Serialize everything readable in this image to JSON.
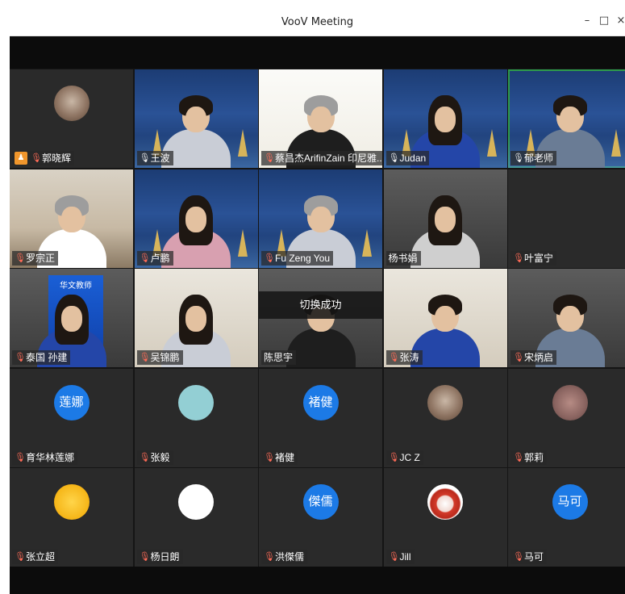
{
  "window": {
    "title": "VooV Meeting",
    "controls": {
      "minimize": "–",
      "maximize": "□",
      "close": "×"
    }
  },
  "participants": [
    {
      "name": "郭晓辉",
      "mic": "muted",
      "host": true,
      "kind": "avatar-photo",
      "active": false
    },
    {
      "name": "王波",
      "mic": "on",
      "host": false,
      "kind": "video-stage",
      "active": false
    },
    {
      "name": "蔡昌杰ArifinZain 印尼雅...",
      "mic": "muted",
      "host": false,
      "kind": "video-paper",
      "active": false
    },
    {
      "name": "Judan",
      "mic": "on",
      "host": false,
      "kind": "video-stage",
      "active": false
    },
    {
      "name": "郁老师",
      "mic": "on",
      "host": false,
      "kind": "video-stage",
      "active": true
    },
    {
      "name": "罗宗正",
      "mic": "muted",
      "host": false,
      "kind": "video-room",
      "active": false
    },
    {
      "name": "卢鹏",
      "mic": "muted",
      "host": false,
      "kind": "video-stage",
      "active": false
    },
    {
      "name": "Fu Zeng You",
      "mic": "muted",
      "host": false,
      "kind": "video-stage",
      "active": false
    },
    {
      "name": "杨书娟",
      "mic": "none",
      "host": false,
      "kind": "video-gray",
      "active": false
    },
    {
      "name": "叶富宁",
      "mic": "muted",
      "host": false,
      "kind": "video-dark",
      "active": false
    },
    {
      "name": "泰国 孙建",
      "mic": "muted",
      "host": false,
      "kind": "video-banner",
      "active": false,
      "banner_text": "华文教师"
    },
    {
      "name": "吴锦鹏",
      "mic": "muted",
      "host": false,
      "kind": "video-wall",
      "active": false
    },
    {
      "name": "陈思宇",
      "mic": "none",
      "host": false,
      "kind": "video-gray",
      "active": false,
      "toast": "切换成功"
    },
    {
      "name": "张涛",
      "mic": "muted",
      "host": false,
      "kind": "video-wall",
      "active": false
    },
    {
      "name": "宋炳启",
      "mic": "muted",
      "host": false,
      "kind": "video-gray",
      "active": false
    },
    {
      "name": "育华林莲娜",
      "mic": "muted",
      "host": false,
      "kind": "avatar-blue",
      "avatar_text": "莲娜",
      "active": false
    },
    {
      "name": "张毅",
      "mic": "muted",
      "host": false,
      "kind": "avatar-teal",
      "active": false
    },
    {
      "name": "褚健",
      "mic": "muted",
      "host": false,
      "kind": "avatar-blue",
      "avatar_text": "褚健",
      "active": false
    },
    {
      "name": "JC Z",
      "mic": "muted",
      "host": false,
      "kind": "avatar-photo",
      "active": false
    },
    {
      "name": "郭莉",
      "mic": "muted",
      "host": false,
      "kind": "avatar-grain",
      "active": false
    },
    {
      "name": "张立超",
      "mic": "muted",
      "host": false,
      "kind": "avatar-sun",
      "active": false
    },
    {
      "name": "杨日朗",
      "mic": "muted",
      "host": false,
      "kind": "avatar-cartoon",
      "active": false
    },
    {
      "name": "洪傑儒",
      "mic": "muted",
      "host": false,
      "kind": "avatar-blue",
      "avatar_text": "傑儒",
      "active": false
    },
    {
      "name": "Jill",
      "mic": "muted",
      "host": false,
      "kind": "avatar-red",
      "active": false
    },
    {
      "name": "马可",
      "mic": "muted",
      "host": false,
      "kind": "avatar-blue",
      "avatar_text": "马可",
      "active": false
    }
  ],
  "icons": {
    "mic": "microphone-icon",
    "host": "host-badge-icon"
  },
  "colors": {
    "active_speaker_border": "#2e9a4b",
    "avatar_blue": "#1c7ae6",
    "muted_mic": "#ff6b57",
    "host_badge": "#f0962c"
  }
}
